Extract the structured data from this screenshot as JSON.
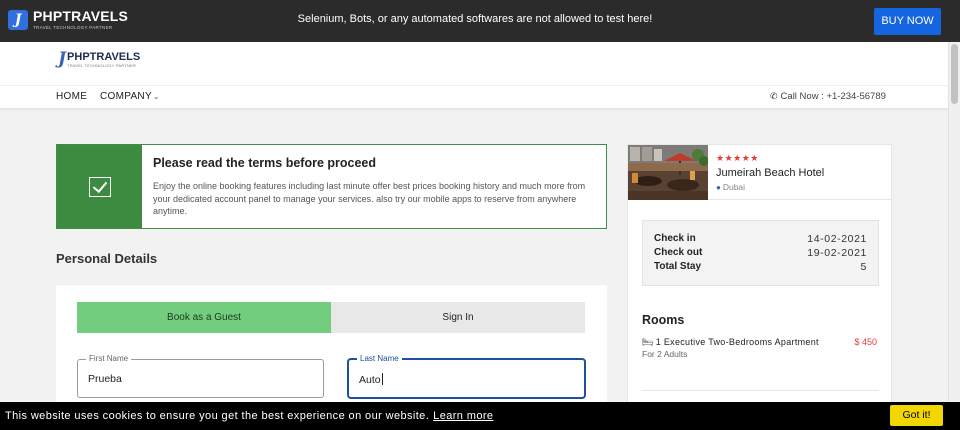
{
  "topbar": {
    "logo_title": "PHPTRAVELS",
    "logo_subtitle": "TRAVEL TECHNOLOGY PARTNER",
    "notice": "Selenium, Bots, or any automated softwares are not allowed to test here!",
    "buy_label": "BUY NOW"
  },
  "header": {
    "logo_title": "PHPTRAVELS",
    "logo_subtitle": "TRAVEL TECHNOLOGY PARTNER"
  },
  "nav": {
    "home": "HOME",
    "company": "COMPANY",
    "call": "Call Now : +1-234-56789"
  },
  "terms": {
    "title": "Please read the terms before proceed",
    "body": "Enjoy the online booking features including last minute offer best prices booking history and much more from your dedicated account panel to manage your services. also try our mobile apps to reserve from anywhere anytime."
  },
  "personal": {
    "title": "Personal Details",
    "tab_guest": "Book as a Guest",
    "tab_signin": "Sign In",
    "first_name_label": "First Name",
    "first_name_value": "Prueba",
    "last_name_label": "Last Name",
    "last_name_value": "Auto"
  },
  "hotel": {
    "stars": "★★★★★",
    "rating": 5,
    "name": "Jumeirah Beach Hotel",
    "location": "Dubai"
  },
  "booking": {
    "checkin_label": "Check in",
    "checkin_value": "14-02-2021",
    "checkout_label": "Check out",
    "checkout_value": "19-02-2021",
    "stay_label": "Total Stay",
    "stay_value": "5",
    "rooms_title": "Rooms",
    "room_desc": "1 Executive Two-Bedrooms Apartment",
    "room_price": "$ 450",
    "room_adults": "For 2 Adults"
  },
  "cookie": {
    "text": "This website uses cookies to ensure you get the best experience on our website.",
    "link": "Learn more",
    "button": "Got it!"
  },
  "colors": {
    "accent_blue": "#1565e0",
    "guest_tab_green": "#72cd7f",
    "terms_green": "#3d8b40",
    "star_red": "#e53935",
    "cookie_yellow": "#f1d600"
  }
}
